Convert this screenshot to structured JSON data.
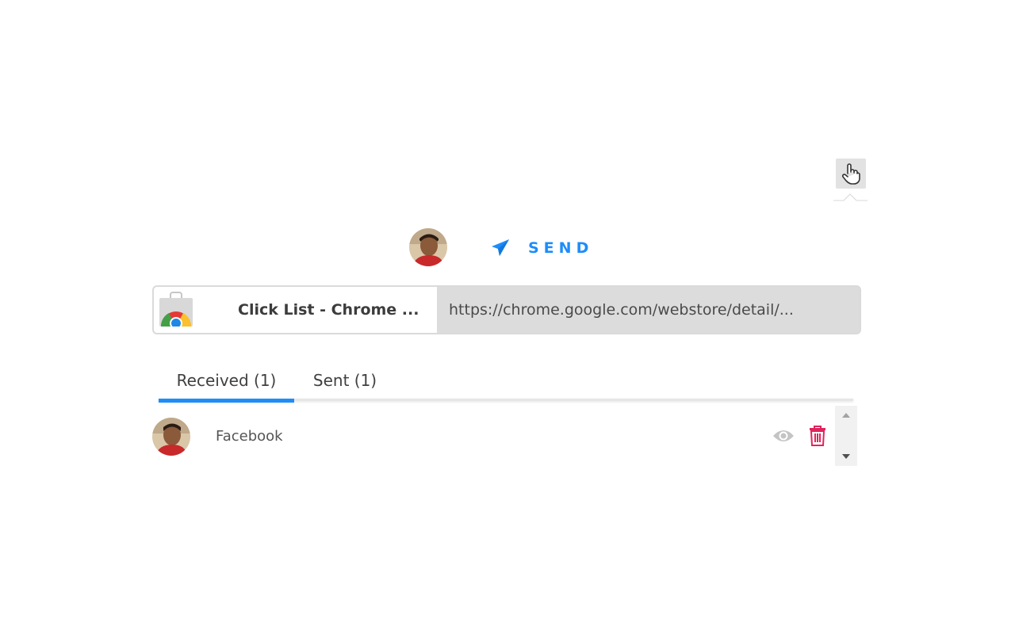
{
  "extension": {
    "icon": "pointing-hand-icon"
  },
  "header": {
    "avatar_icon": "user-avatar",
    "send_icon": "paper-plane-icon",
    "send_label": "SEND",
    "accent_color": "#1d8dfa"
  },
  "page_card": {
    "favicon": "chrome-web-store-icon",
    "title": "Click List - Chrome ...",
    "url": "https://chrome.google.com/webstore/detail/..."
  },
  "tabs": [
    {
      "label": "Received (1)",
      "active": true
    },
    {
      "label": "Sent (1)",
      "active": false
    }
  ],
  "list": {
    "items": [
      {
        "avatar_icon": "user-avatar",
        "title": "Facebook",
        "actions": [
          "eye-icon",
          "trash-icon"
        ]
      }
    ]
  },
  "colors": {
    "delete": "#e0245e",
    "view": "#c4c4c4"
  }
}
